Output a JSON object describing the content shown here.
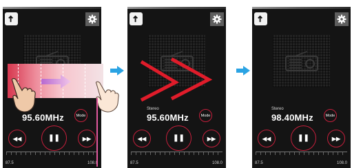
{
  "screens": [
    {
      "stereo": "",
      "frequency": "95.60MHz",
      "mode_label": "Mode",
      "scale_min": "87.5",
      "scale_max": "108.0"
    },
    {
      "stereo": "Stereo",
      "frequency": "95.60MHz",
      "mode_label": "Mode",
      "scale_min": "87.5",
      "scale_max": "108.0"
    },
    {
      "stereo": "Stereo",
      "frequency": "98.40MHz",
      "mode_label": "Mode",
      "scale_min": "87.5",
      "scale_max": "108.0"
    }
  ],
  "icons": {
    "back": "back-arrow-icon",
    "settings": "gear-icon",
    "art": "radio-icon",
    "prev": "rewind-icon",
    "pause": "pause-icon",
    "next": "fast-forward-icon",
    "flow": "blue-triangle-arrow-icon"
  },
  "colors": {
    "accent": "#c61f3c",
    "flow_arrow": "#2aa3e3",
    "swipe_chevrons": "#e01c2a",
    "swipe_band": "#ee8e9d"
  }
}
